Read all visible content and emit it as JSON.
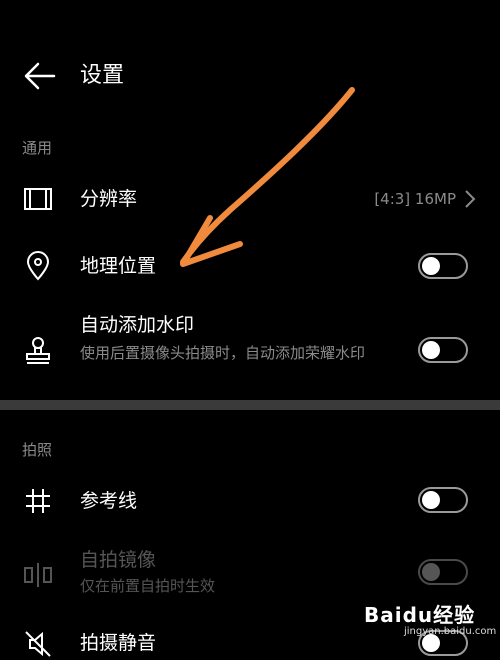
{
  "header": {
    "title": "设置"
  },
  "sections": {
    "general": "通用",
    "photo": "拍照"
  },
  "rows": {
    "resolution": {
      "title": "分辨率",
      "value": "[4:3] 16MP"
    },
    "location": {
      "title": "地理位置",
      "enabled": false
    },
    "watermark": {
      "title": "自动添加水印",
      "subtitle": "使用后置摄像头拍摄时，自动添加荣耀水印",
      "enabled": false
    },
    "grid": {
      "title": "参考线",
      "enabled": false
    },
    "mirror": {
      "title": "自拍镜像",
      "subtitle": "仅在前置自拍时生效",
      "enabled": false,
      "disabled": true
    },
    "mute": {
      "title": "拍摄静音",
      "enabled": false
    }
  },
  "annotation": {
    "arrow_color": "#f08a3c"
  },
  "logo": {
    "brand": "Baidu经验",
    "url_text": "jingyan.baidu.com"
  }
}
